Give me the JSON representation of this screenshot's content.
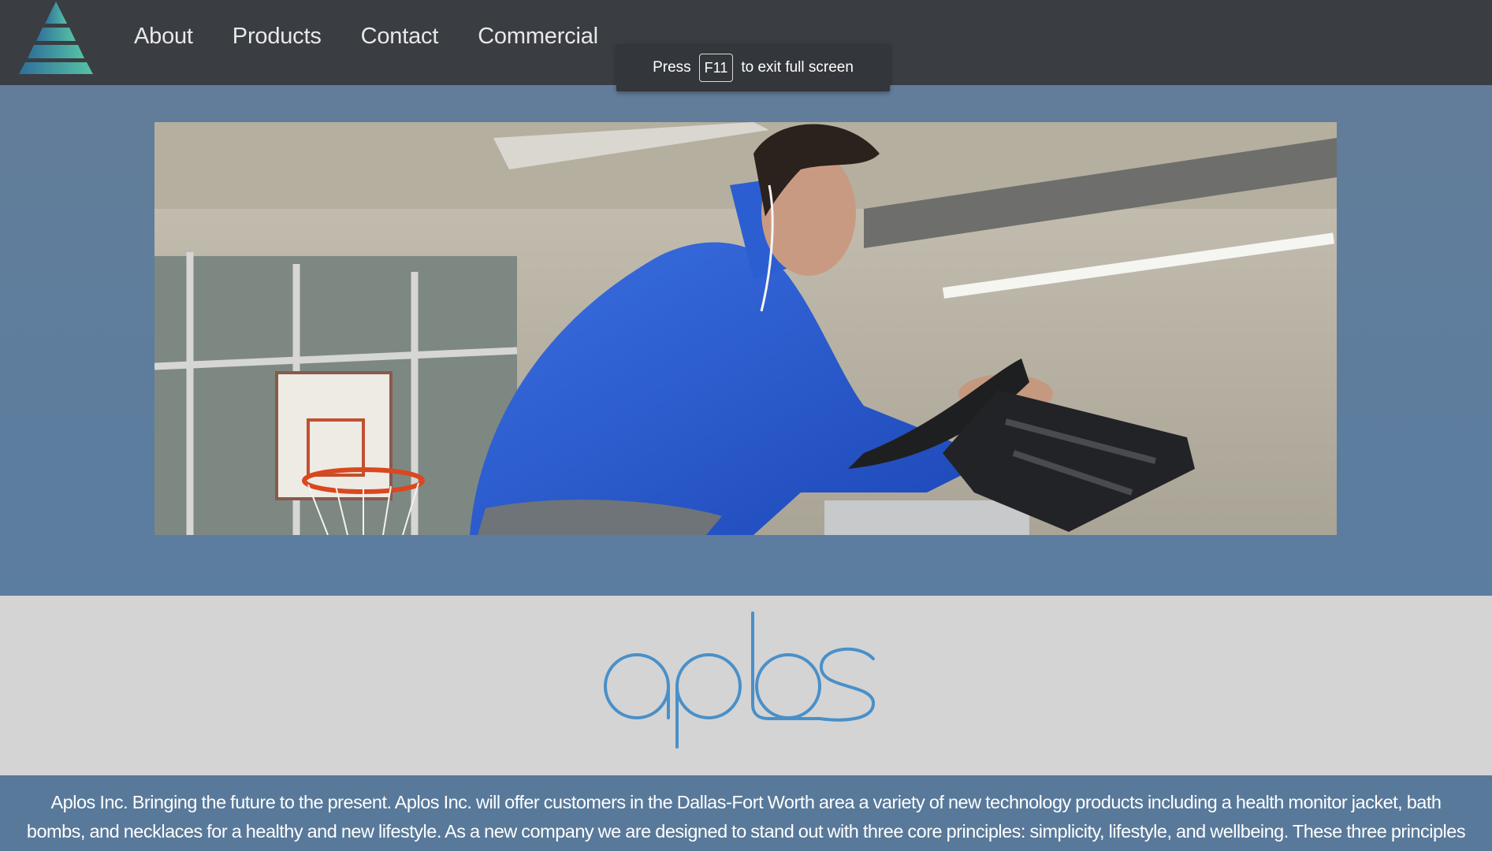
{
  "nav": {
    "logo_icon": "pyramid-logo-icon",
    "links": [
      {
        "label": "About"
      },
      {
        "label": "Products"
      },
      {
        "label": "Contact"
      },
      {
        "label": "Commercial"
      }
    ]
  },
  "fullscreen_toast": {
    "prefix": "Press",
    "key": "F11",
    "suffix": "to exit full screen"
  },
  "hero": {
    "image_icon": "hero-photo"
  },
  "brand": {
    "wordmark": "aplos",
    "color": "#4a90c8"
  },
  "description": {
    "text": "Aplos Inc. Bringing the future to the present. Aplos Inc. will offer customers in the Dallas-Fort Worth area a variety of new technology products including a health monitor jacket, bath bombs, and necklaces for a healthy and new lifestyle. As a new company we are designed to stand out with three core principles: simplicity, lifestyle, and wellbeing. These three principles will be well represented in all of the stores and"
  },
  "colors": {
    "topbar": "#3a3d42",
    "hero_band": "#5f7c9a",
    "brand_band": "#d4d4d4",
    "desc_band": "#58799a"
  }
}
